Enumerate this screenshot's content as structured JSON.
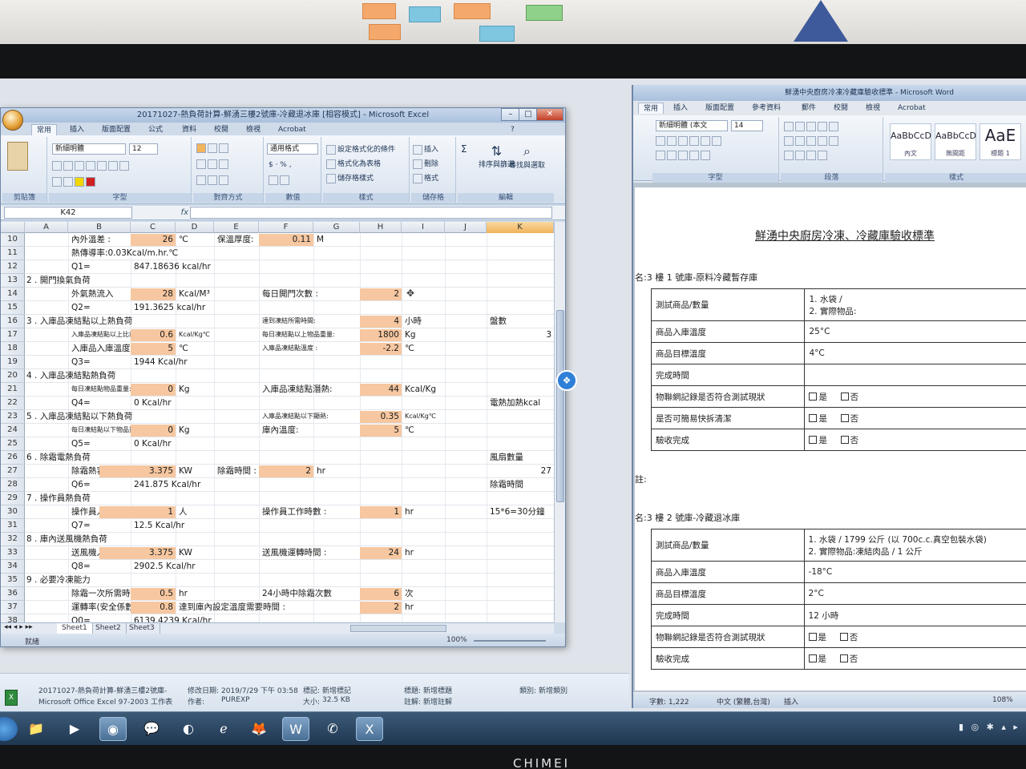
{
  "excel": {
    "title": "20171027-熱負荷計算-鮮湧三樓2號庫-冷藏退冰庫 [相容模式] - Microsoft Excel",
    "tabs": [
      "常用",
      "插入",
      "版面配置",
      "公式",
      "資料",
      "校閱",
      "檢視",
      "Acrobat"
    ],
    "ribbon": {
      "font_name": "新細明體",
      "font_size": "12",
      "number_format": "通用格式",
      "conditional_format": "設定格式化的條件",
      "format_as_table": "格式化為表格",
      "cell_styles": "儲存格樣式",
      "insert": "插入",
      "delete": "刪除",
      "format": "格式",
      "sort_filter": "排序與篩選",
      "find_select": "尋找與選取",
      "groups": [
        "剪貼簿",
        "字型",
        "對齊方式",
        "數值",
        "樣式",
        "儲存格",
        "編輯"
      ]
    },
    "name_box": "K42",
    "fx": "fx",
    "columns": [
      "A",
      "B",
      "C",
      "D",
      "E",
      "F",
      "G",
      "H",
      "I",
      "J",
      "K"
    ],
    "rows": [
      "10",
      "11",
      "12",
      "13",
      "14",
      "15",
      "16",
      "17",
      "18",
      "19",
      "20",
      "21",
      "22",
      "23",
      "24",
      "25",
      "26",
      "27",
      "28",
      "29",
      "30",
      "31",
      "32",
      "33",
      "34",
      "35",
      "36",
      "37",
      "38"
    ],
    "cells": {
      "r10_b": "內外溫差 :",
      "r10_c": "26",
      "r10_d": "℃",
      "r10_e": "保溫厚度:",
      "r10_f": "0.11",
      "r10_g": "M",
      "r11_b": "熱傳導率:0.03Kcal/m.hr.℃",
      "r12_b": "Q1=",
      "r12_c": "847.18636 kcal/hr",
      "r13_a": "2 . 開門換氣負荷",
      "r14_b": "外氣熱流入",
      "r14_c": "28",
      "r14_d": "Kcal/M³",
      "r14_f": "每日開門次數 :",
      "r14_h": "2",
      "r15_b": "Q2=",
      "r15_c": "191.3625 kcal/hr",
      "r16_a": "3 . 入庫品凍結點以上熱負荷",
      "r16_f": "達到凍結所需時間:",
      "r16_h": "4",
      "r16_i": "小時",
      "r16_k": "盤數",
      "r17_b": "入庫品凍結點以上比熱 :",
      "r17_c": "0.6",
      "r17_d": "Kcal/Kg℃",
      "r17_f": "每日凍結點以上物品重量:",
      "r17_h": "1800",
      "r17_i": "Kg",
      "r17_k": "3",
      "r18_b": "入庫品入庫溫度 :",
      "r18_c": "5",
      "r18_d": "℃",
      "r18_f": "入庫品凍結點溫度 :",
      "r18_h": "-2.2",
      "r18_i": "℃",
      "r19_b": "Q3=",
      "r19_c": "1944 Kcal/hr",
      "r20_a": "4 . 入庫品凍結點熱負荷",
      "r21_b": "每日凍結點物品重量:",
      "r21_c": "0",
      "r21_d": "Kg",
      "r21_f": "入庫品凍結點潛熱:",
      "r21_h": "44",
      "r21_i": "Kcal/Kg",
      "r22_b": "Q4=",
      "r22_c": "0 Kcal/hr",
      "r22_k": "電熱加熱kcal",
      "r23_a": "5 . 入庫品凍結點以下熱負荷",
      "r23_f": "入庫品凍結點以下顯熱:",
      "r23_h": "0.35",
      "r23_i": "Kcal/Kg℃",
      "r24_b": "每日凍結點以下物品重量:",
      "r24_c": "0",
      "r24_d": "Kg",
      "r24_f": "庫內溫度:",
      "r24_h": "5",
      "r24_i": "℃",
      "r25_b": "Q5=",
      "r25_c": "0 Kcal/hr",
      "r26_a": "6 . 除霜電熱負荷",
      "r26_k": "風扇數量",
      "r27_b": "除霜熱容量",
      "r27_c": "3.375",
      "r27_d": "KW",
      "r27_e": "除霜時間 :",
      "r27_f": "2",
      "r27_g": "hr",
      "r27_k": "27",
      "r28_b": "Q6=",
      "r28_c": "241.875 Kcal/hr",
      "r28_k": "除霜時間",
      "r29_a": "7 . 操作員熱負荷",
      "r30_b": "操作員人數",
      "r30_c": "1",
      "r30_d": "人",
      "r30_f": "操作員工作時數 :",
      "r30_h": "1",
      "r30_i": "hr",
      "r30_k": "15*6=30分鐘",
      "r31_b": "Q7=",
      "r31_c": "12.5 Kcal/hr",
      "r32_a": "8 . 庫內送風機熱負荷",
      "r33_b": "送風機入力",
      "r33_c": "3.375",
      "r33_d": "KW",
      "r33_f": "送風機運轉時間 :",
      "r33_h": "24",
      "r33_i": "hr",
      "r34_b": "Q8=",
      "r34_c": "2902.5 Kcal/hr",
      "r35_a": "9 . 必要冷凍能力",
      "r36_b": "除霜一次所需時間 :",
      "r36_c": "0.5",
      "r36_d": "hr",
      "r36_f": "24小時中除霜次數",
      "r36_h": "6",
      "r36_i": "次",
      "r37_b": "運轉率(安全係數) :",
      "r37_c": "0.8",
      "r37_d": "達到庫內設定溫度需要時間 :",
      "r37_h": "2",
      "r37_i": "hr",
      "r38_b": "Q0=",
      "r38_c": "6139.4239 Kcal/hr"
    },
    "sheets": [
      "Sheet1",
      "Sheet2",
      "Sheet3"
    ],
    "status": "就緒",
    "zoom": "100%"
  },
  "explorer": {
    "filename": "20171027-熱負荷計算-鮮湧三樓2號庫-",
    "filetype": "Microsoft Office Excel 97-2003 工作表",
    "modified_label": "修改日期:",
    "modified": "2019/7/29 下午 03:58",
    "tags_label": "標記:",
    "tags_value": "新增標記",
    "author_label": "作者:",
    "author": "PUREXP",
    "size_label": "大小:",
    "size": "32.5 KB",
    "title_label": "標題:",
    "title_value": "新增標題",
    "comment_label": "註解:",
    "comment_value": "新增註解",
    "category_label": "類別:",
    "category_value": "新增類別"
  },
  "word": {
    "title": "鮮湧中央廚房冷凍冷藏庫驗收標準 - Microsoft Word",
    "tabs": [
      "常用",
      "插入",
      "版面配置",
      "參考資料",
      "郵件",
      "校閱",
      "檢視",
      "Acrobat"
    ],
    "font_name": "新細明體 (本文",
    "font_size": "14",
    "styles": [
      {
        "sample": "AaBbCcD",
        "name": "內文"
      },
      {
        "sample": "AaBbCcD",
        "name": "無間距"
      },
      {
        "sample": "AaE",
        "name": "標題 1"
      }
    ],
    "groups": [
      "字型",
      "段落",
      "樣式"
    ],
    "doc_title": "鮮湧中央廚房冷凍、冷藏庫驗收標準",
    "section1": "名:3 樓 1 號庫-原料冷藏暫存庫",
    "table1": [
      {
        "k": "測試商品/數量",
        "v1": "1.   水袋 /",
        "v2": "2.   實際物品:"
      },
      {
        "k": "商品入庫溫度",
        "v": "25°C"
      },
      {
        "k": "商品目標溫度",
        "v": "4°C"
      },
      {
        "k": "完成時間",
        "v": ""
      },
      {
        "k": "物聯網記錄是否符合測試現狀",
        "c1": "是",
        "c2": "否"
      },
      {
        "k": "是否可簡易快拆清潔",
        "c1": "是",
        "c2": "否"
      },
      {
        "k": "驗收完成",
        "c1": "是",
        "c2": "否"
      }
    ],
    "between": "註:",
    "section2": "名:3 樓 2 號庫-冷藏退冰庫",
    "table2": [
      {
        "k": "測試商品/數量",
        "v1": "1.   水袋 / 1799 公斤 (以 700c.c.真空包裝水袋)",
        "v2": "2.   實際物品:凍結肉品 / 1 公斤"
      },
      {
        "k": "商品入庫溫度",
        "v": "-18°C"
      },
      {
        "k": "商品目標溫度",
        "v": "2°C"
      },
      {
        "k": "完成時間",
        "v": "12 小時"
      },
      {
        "k": "物聯網記錄是否符合測試現狀",
        "c1": "是",
        "c2": "否"
      },
      {
        "k": "驗收完成",
        "c1": "是",
        "c2": "否"
      }
    ],
    "status": "字數: 1,222",
    "lang": "中文 (繁體,台灣)",
    "mode": "插入",
    "zoom": "108%"
  },
  "monitor_brand": "CHIMEI",
  "colors": {
    "input_fill": "#f6c7a0",
    "selected_col": "#f1b25a",
    "dropbox": "#2e7fd8"
  }
}
